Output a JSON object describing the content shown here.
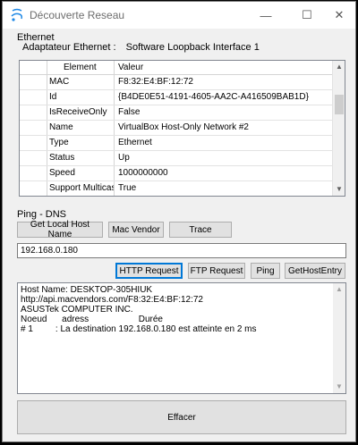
{
  "window": {
    "title": "Découverte Reseau",
    "minimize_glyph": "—",
    "maximize_glyph": "☐",
    "close_glyph": "✕",
    "app_icon": "network-tool-icon"
  },
  "ethernet": {
    "group_label": "Ethernet",
    "adapter_label": "Adaptateur Ethernet :",
    "adapter_value": "Software Loopback Interface 1",
    "columns": [
      "Element",
      "Valeur"
    ],
    "rows": [
      {
        "element": "MAC",
        "value": "F8:32:E4:BF:12:72"
      },
      {
        "element": "Id",
        "value": "{B4DE0E51-4191-4605-AA2C-A416509BAB1D}"
      },
      {
        "element": "IsReceiveOnly",
        "value": "False"
      },
      {
        "element": "Name",
        "value": "VirtualBox Host-Only Network #2"
      },
      {
        "element": "Type",
        "value": "Ethernet"
      },
      {
        "element": "Status",
        "value": "Up"
      },
      {
        "element": "Speed",
        "value": "1000000000"
      },
      {
        "element": "Support Multicast",
        "value": "True"
      }
    ]
  },
  "ping": {
    "group_label": "Ping - DNS",
    "get_host_label": "Get Local Host Name",
    "mac_vendor_label": "Mac Vendor",
    "trace_label": "Trace",
    "ip_value": "192.168.0.180",
    "http_label": "HTTP Request",
    "ftp_label": "FTP Request",
    "ping_label": "Ping",
    "gethostentry_label": "GetHostEntry",
    "output_lines": [
      "Host Name: DESKTOP-305HIUK",
      "http://api.macvendors.com/F8:32:E4:BF:12:72",
      "ASUSTek COMPUTER INC.",
      "Noeud      adress                    Durée",
      "# 1         : La destination 192.168.0.180 est atteinte en 2 ms"
    ]
  },
  "clear_label": "Effacer",
  "colors": {
    "window_bg": "#f0f0f0",
    "accent": "#0078d7",
    "icon_blue": "#1e88e5"
  }
}
